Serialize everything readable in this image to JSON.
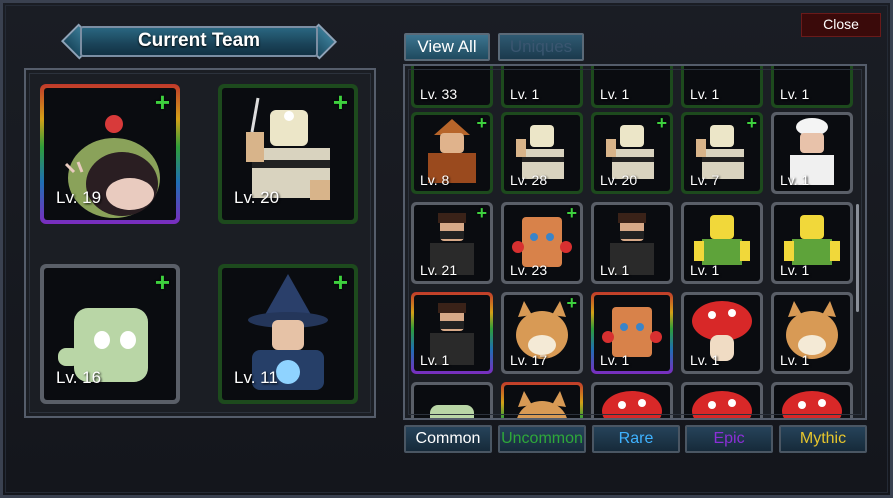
{
  "title": "Current Team",
  "close_label": "Close",
  "filter_tabs": [
    {
      "label": "View All",
      "active": true
    },
    {
      "label": "Uniques",
      "active": false
    }
  ],
  "team": [
    {
      "level": "Lv. 19",
      "rarity": "mythic",
      "has_plus": true,
      "character": "snail-icon"
    },
    {
      "level": "Lv. 20",
      "rarity": "uncommon",
      "has_plus": true,
      "character": "miner-icon"
    },
    {
      "level": "Lv. 16",
      "rarity": "common",
      "has_plus": true,
      "character": "green-cube-icon"
    },
    {
      "level": "Lv. 11",
      "rarity": "uncommon",
      "has_plus": true,
      "character": "wizard-icon"
    }
  ],
  "inventory_rows": [
    [
      {
        "level": "Lv. 33",
        "rarity": "uncommon",
        "plus": false
      },
      {
        "level": "Lv. 1",
        "rarity": "uncommon",
        "plus": false
      },
      {
        "level": "Lv. 1",
        "rarity": "uncommon",
        "plus": false
      },
      {
        "level": "Lv. 1",
        "rarity": "uncommon",
        "plus": false
      },
      {
        "level": "Lv. 1",
        "rarity": "uncommon",
        "plus": false
      }
    ],
    [
      {
        "level": "Lv. 8",
        "rarity": "uncommon",
        "plus": true,
        "character": "samurai-icon"
      },
      {
        "level": "Lv. 28",
        "rarity": "uncommon",
        "plus": false,
        "character": "miner-icon"
      },
      {
        "level": "Lv. 20",
        "rarity": "uncommon",
        "plus": true,
        "character": "miner-icon"
      },
      {
        "level": "Lv. 7",
        "rarity": "uncommon",
        "plus": true,
        "character": "miner-icon"
      },
      {
        "level": "Lv. 1",
        "rarity": "common",
        "plus": false,
        "character": "chef-icon"
      }
    ],
    [
      {
        "level": "Lv. 21",
        "rarity": "common",
        "plus": true,
        "character": "masked-guy-icon"
      },
      {
        "level": "Lv. 23",
        "rarity": "common",
        "plus": true,
        "character": "wood-block-icon"
      },
      {
        "level": "Lv. 1",
        "rarity": "common",
        "plus": false,
        "character": "masked-guy-icon"
      },
      {
        "level": "Lv. 1",
        "rarity": "common",
        "plus": false,
        "character": "noob-icon"
      },
      {
        "level": "Lv. 1",
        "rarity": "common",
        "plus": false,
        "character": "noob-icon"
      }
    ],
    [
      {
        "level": "Lv. 1",
        "rarity": "mythic",
        "plus": false,
        "character": "masked-guy-icon"
      },
      {
        "level": "Lv. 17",
        "rarity": "common",
        "plus": true,
        "character": "cat-icon"
      },
      {
        "level": "Lv. 1",
        "rarity": "mythic",
        "plus": false,
        "character": "wood-block-icon"
      },
      {
        "level": "Lv. 1",
        "rarity": "common",
        "plus": false,
        "character": "mushroom-icon"
      },
      {
        "level": "Lv. 1",
        "rarity": "common",
        "plus": false,
        "character": "cat-icon"
      }
    ],
    [
      {
        "level": "",
        "rarity": "common",
        "plus": false,
        "character": "green-cube-icon"
      },
      {
        "level": "",
        "rarity": "mythic",
        "plus": false,
        "character": "cat-icon"
      },
      {
        "level": "",
        "rarity": "common",
        "plus": false,
        "character": "mushroom-icon"
      },
      {
        "level": "",
        "rarity": "common",
        "plus": false,
        "character": "mushroom-icon"
      },
      {
        "level": "",
        "rarity": "common",
        "plus": false,
        "character": "mushroom-icon"
      }
    ]
  ],
  "rarity_filters": [
    {
      "label": "Common",
      "color": "#ffffff"
    },
    {
      "label": "Uncommon",
      "color": "#2ea83a"
    },
    {
      "label": "Rare",
      "color": "#3fb2ff"
    },
    {
      "label": "Epic",
      "color": "#8b2fd6"
    },
    {
      "label": "Mythic",
      "color": "#e6c52c"
    }
  ]
}
